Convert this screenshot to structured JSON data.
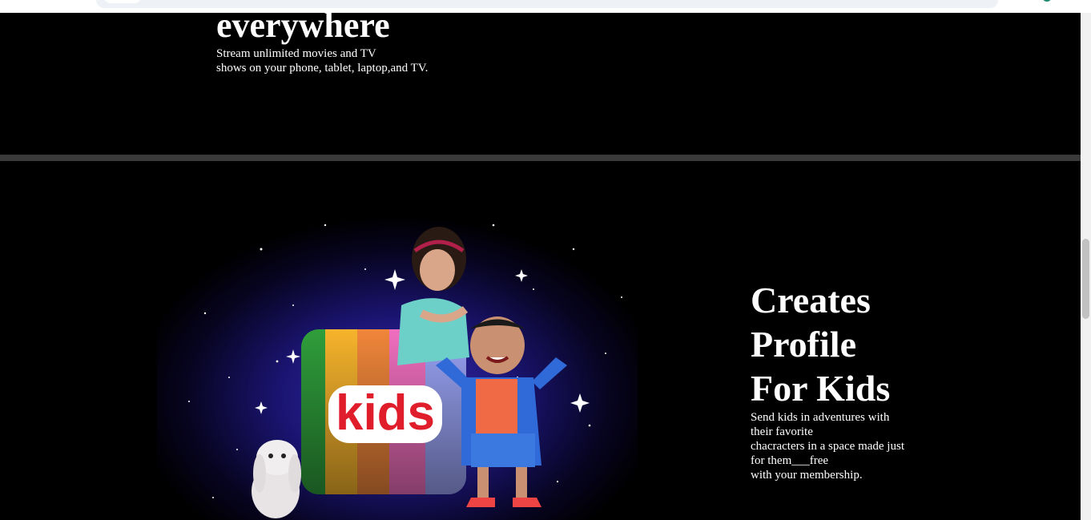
{
  "section_everywhere": {
    "title": "everywhere",
    "description_lines": [
      "Stream unlimited movies and TV",
      "shows on your phone, tablet, laptop,and TV."
    ]
  },
  "section_kids": {
    "title_lines": [
      "Creates",
      "Profile",
      "For Kids"
    ],
    "description_lines": [
      "Send kids in adventures with",
      "their favorite",
      "chacracters in a space made just",
      "for them___free",
      "with your membership."
    ],
    "image": {
      "logo_text": "kids"
    }
  },
  "colors": {
    "background": "#000000",
    "divider": "#3a3a3a",
    "text": "#ffffff",
    "kids_logo_red": "#e01e2b"
  }
}
